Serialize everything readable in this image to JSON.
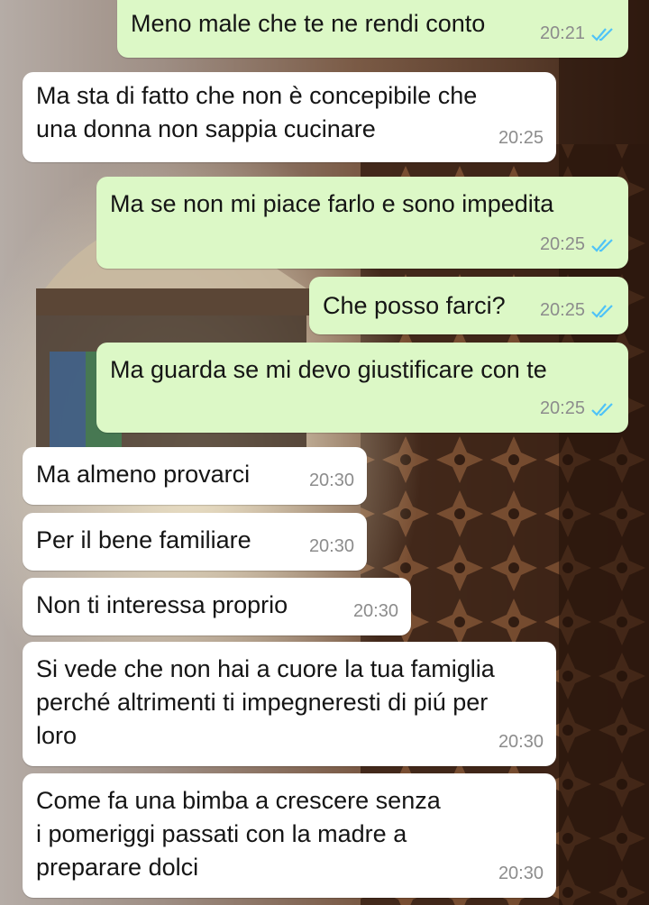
{
  "colors": {
    "incoming_bubble": "#ffffff",
    "outgoing_bubble": "#dcf8c6",
    "read_ticks": "#4fc3f7",
    "timestamp": "#8c8c8c"
  },
  "messages": [
    {
      "id": "m1",
      "direction": "out",
      "text": "Meno male che te ne rendi conto",
      "time": "20:21",
      "status": "read"
    },
    {
      "id": "m2",
      "direction": "in",
      "text": "Ma sta di fatto che non è concepibile che\nuna donna non sappia cucinare",
      "time": "20:25"
    },
    {
      "id": "m3",
      "direction": "out",
      "text": "Ma se non mi piace farlo e sono impedita",
      "time": "20:25",
      "status": "read"
    },
    {
      "id": "m4",
      "direction": "out",
      "text": "Che posso farci?",
      "time": "20:25",
      "status": "read"
    },
    {
      "id": "m5",
      "direction": "out",
      "text": "Ma guarda se mi devo giustificare con te",
      "time": "20:25",
      "status": "read"
    },
    {
      "id": "m6",
      "direction": "in",
      "text": "Ma almeno provarci",
      "time": "20:30"
    },
    {
      "id": "m7",
      "direction": "in",
      "text": "Per il bene familiare",
      "time": "20:30"
    },
    {
      "id": "m8",
      "direction": "in",
      "text": "Non ti interessa proprio",
      "time": "20:30"
    },
    {
      "id": "m9",
      "direction": "in",
      "text": "Si vede che non hai a cuore la tua famiglia\nperché altrimenti ti impegneresti di piú per\nloro",
      "time": "20:30"
    },
    {
      "id": "m10",
      "direction": "in",
      "text": "Come fa una bimba a crescere senza\ni pomeriggi passati con la madre a\npreparare dolci",
      "time": "20:30"
    }
  ]
}
